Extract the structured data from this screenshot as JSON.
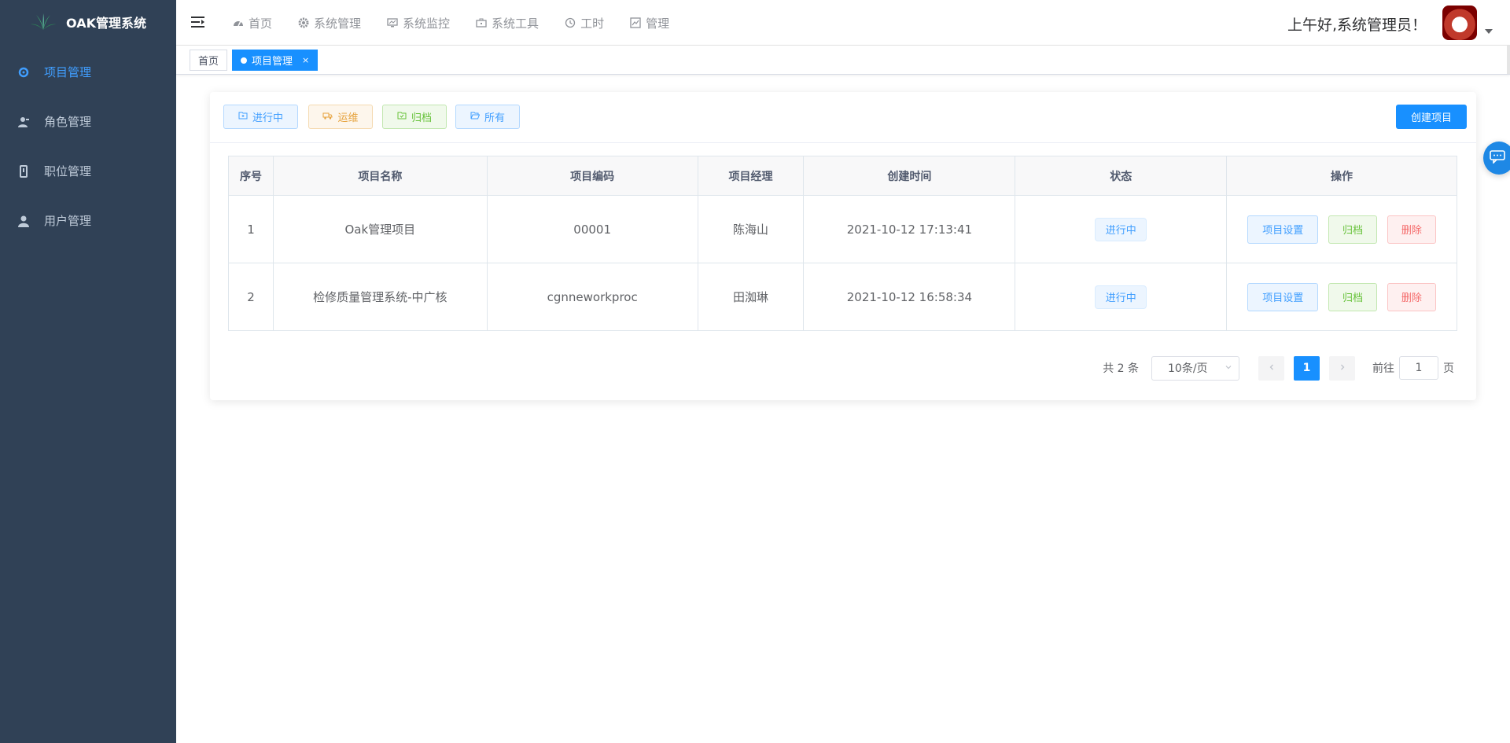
{
  "app": {
    "title": "OAK管理系统"
  },
  "sidebar": {
    "items": [
      {
        "label": "项目管理",
        "icon": "project-icon",
        "active": true
      },
      {
        "label": "角色管理",
        "icon": "role-icon"
      },
      {
        "label": "职位管理",
        "icon": "post-icon"
      },
      {
        "label": "用户管理",
        "icon": "user-icon"
      }
    ]
  },
  "topnav": {
    "items": [
      {
        "label": "首页",
        "icon": "dashboard-icon"
      },
      {
        "label": "系统管理",
        "icon": "gear-icon"
      },
      {
        "label": "系统监控",
        "icon": "monitor-icon"
      },
      {
        "label": "系统工具",
        "icon": "toolbox-icon"
      },
      {
        "label": "工时",
        "icon": "clock-icon"
      },
      {
        "label": "管理",
        "icon": "chart-icon"
      }
    ],
    "greeting": "上午好,系统管理员！"
  },
  "tags": {
    "home": "首页",
    "active": "项目管理",
    "close": "×"
  },
  "filters": [
    {
      "label": "进行中",
      "icon": "folder-add-icon"
    },
    {
      "label": "运维",
      "icon": "truck-icon"
    },
    {
      "label": "归档",
      "icon": "folder-checked-icon"
    },
    {
      "label": "所有",
      "icon": "folder-opened-icon"
    }
  ],
  "create_button": "创建项目",
  "table": {
    "columns": [
      "序号",
      "项目名称",
      "项目编码",
      "项目经理",
      "创建时间",
      "状态",
      "操作"
    ],
    "rows": [
      {
        "index": "1",
        "name": "Oak管理项目",
        "code": "00001",
        "manager": "陈海山",
        "created": "2021-10-12 17:13:41",
        "status": "进行中"
      },
      {
        "index": "2",
        "name": "检修质量管理系统-中广核",
        "code": "cgnneworkproc",
        "manager": "田洳琳",
        "created": "2021-10-12 16:58:34",
        "status": "进行中"
      }
    ],
    "actions": {
      "settings": "项目设置",
      "archive": "归档",
      "delete": "删除"
    }
  },
  "pagination": {
    "total": "共 2 条",
    "page_size": "10条/页",
    "current": "1",
    "goto_prefix": "前往",
    "goto_value": "1",
    "goto_suffix": "页"
  },
  "colors": {
    "sidebar_bg": "#304156",
    "primary": "#1890ff",
    "active_menu": "#409eff"
  }
}
